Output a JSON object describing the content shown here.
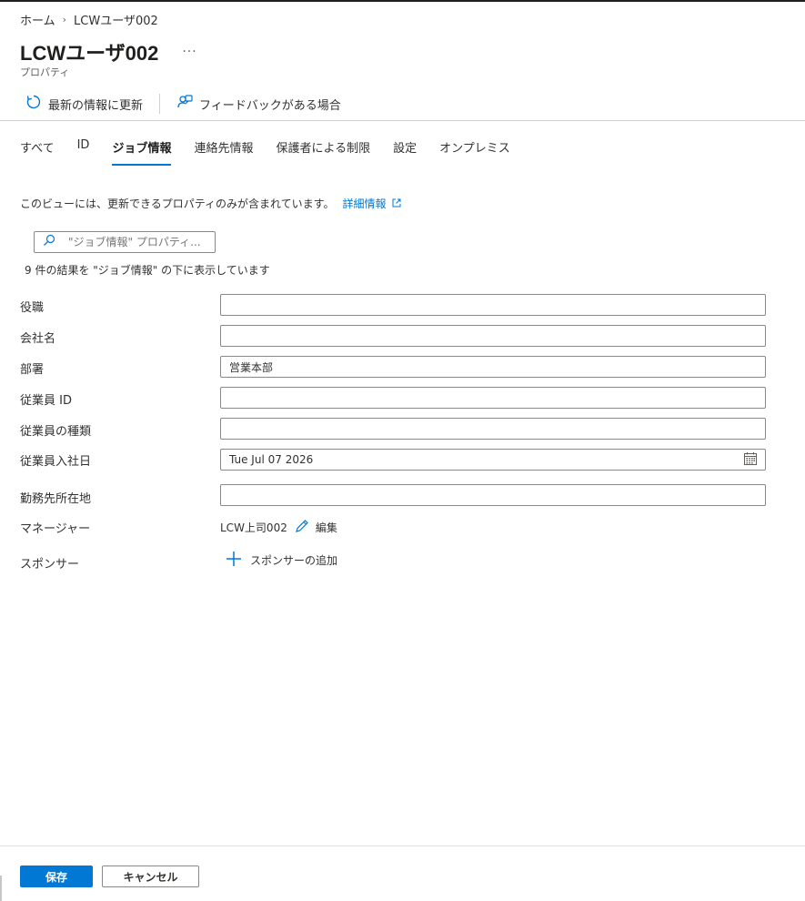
{
  "breadcrumb": {
    "home": "ホーム",
    "separator": "›",
    "current": "LCWユーザ002"
  },
  "header": {
    "title": "LCWユーザ002",
    "more": "···",
    "subtitle": "プロパティ"
  },
  "toolbar": {
    "refresh": "最新の情報に更新",
    "feedback": "フィードバックがある場合"
  },
  "tabs": [
    {
      "label": "すべて"
    },
    {
      "label": "ID"
    },
    {
      "label": "ジョブ情報",
      "active": true
    },
    {
      "label": "連絡先情報"
    },
    {
      "label": "保護者による制限"
    },
    {
      "label": "設定"
    },
    {
      "label": "オンプレミス"
    }
  ],
  "info": {
    "text": "このビューには、更新できるプロパティのみが含まれています。",
    "link": "詳細情報"
  },
  "search": {
    "placeholder": "\"ジョブ情報\" プロパティ..."
  },
  "result_count": "9 件の結果を \"ジョブ情報\" の下に表示しています",
  "fields": {
    "job_title": {
      "label": "役職",
      "value": ""
    },
    "company": {
      "label": "会社名",
      "value": ""
    },
    "department": {
      "label": "部署",
      "value": "営業本部"
    },
    "employee_id": {
      "label": "従業員 ID",
      "value": ""
    },
    "employee_type": {
      "label": "従業員の種類",
      "value": ""
    },
    "hire_date": {
      "label": "従業員入社日",
      "value": "Tue Jul 07 2026"
    },
    "office_location": {
      "label": "勤務先所在地",
      "value": ""
    },
    "manager": {
      "label": "マネージャー",
      "value": "LCW上司002",
      "edit": "編集"
    },
    "sponsor": {
      "label": "スポンサー",
      "add": "スポンサーの追加"
    }
  },
  "footer": {
    "save": "保存",
    "cancel": "キャンセル"
  },
  "colors": {
    "accent": "#0078d4",
    "text": "#323130",
    "border": "#8a8886"
  }
}
